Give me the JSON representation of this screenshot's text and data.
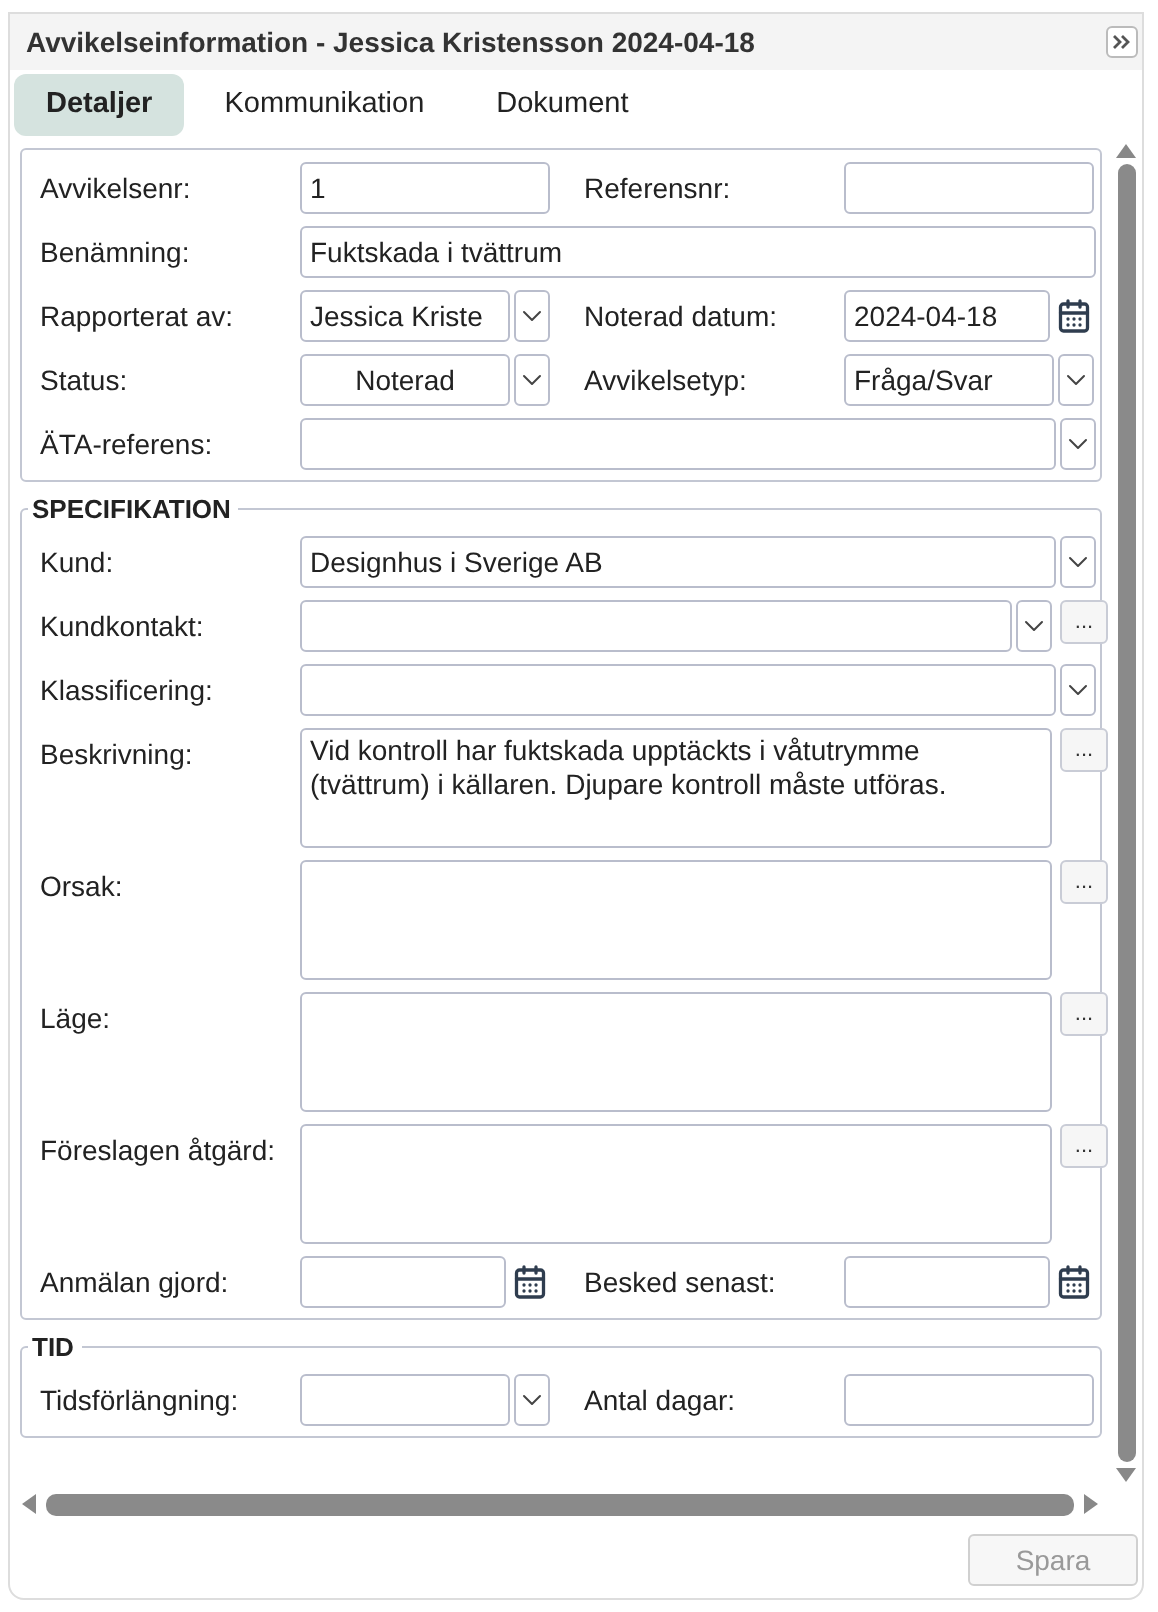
{
  "window": {
    "title": "Avvikelseinformation - Jessica Kristensson 2024-04-18"
  },
  "tabs": [
    {
      "label": "Detaljer",
      "selected": true
    },
    {
      "label": "Kommunikation",
      "selected": false
    },
    {
      "label": "Dokument",
      "selected": false
    }
  ],
  "sections": [
    {
      "rows": [
        {
          "kind": "pair",
          "fields": [
            {
              "label": "Avvikelsenr:",
              "kind": "text",
              "value": "1"
            },
            {
              "label": "Referensnr:",
              "kind": "text"
            }
          ]
        },
        {
          "kind": "full",
          "field": {
            "label": "Benämning:",
            "kind": "text",
            "value": "Fuktskada i tvättrum"
          }
        },
        {
          "kind": "pair",
          "fields": [
            {
              "label": "Rapporterat av:",
              "kind": "select",
              "value": "Jessica Kriste"
            },
            {
              "label": "Noterad datum:",
              "kind": "date",
              "value": "2024-04-18"
            }
          ]
        },
        {
          "kind": "pair",
          "fields": [
            {
              "label": "Status:",
              "kind": "select",
              "value": "Noterad",
              "centered": true
            },
            {
              "label": "Avvikelsetyp:",
              "kind": "select",
              "value": "Fråga/Svar"
            }
          ]
        },
        {
          "kind": "full",
          "field": {
            "label": "ÄTA-referens:",
            "kind": "select"
          }
        }
      ]
    },
    {
      "title": "SPECIFIKATION",
      "rows": [
        {
          "kind": "full",
          "field": {
            "label": "Kund:",
            "kind": "select",
            "value": "Designhus i Sverige AB"
          }
        },
        {
          "kind": "full",
          "field": {
            "label": "Kundkontakt:",
            "kind": "select",
            "more": "..."
          }
        },
        {
          "kind": "full",
          "field": {
            "label": "Klassificering:",
            "kind": "select"
          }
        },
        {
          "kind": "full",
          "field": {
            "label": "Beskrivning:",
            "kind": "textarea",
            "value": "Vid kontroll har fuktskada upptäckts i våtutrymme (tvättrum) i källaren. Djupare kontroll måste utföras.",
            "more": "..."
          }
        },
        {
          "kind": "full",
          "field": {
            "label": "Orsak:",
            "kind": "textarea",
            "more": "..."
          }
        },
        {
          "kind": "full",
          "field": {
            "label": "Läge:",
            "kind": "textarea",
            "more": "..."
          }
        },
        {
          "kind": "full",
          "field": {
            "label": "Föreslagen åtgärd:",
            "kind": "textarea",
            "more": "..."
          }
        },
        {
          "kind": "pair",
          "fields": [
            {
              "label": "Anmälan gjord:",
              "kind": "date"
            },
            {
              "label": "Besked senast:",
              "kind": "date"
            }
          ]
        }
      ]
    },
    {
      "title": "TID",
      "rows": [
        {
          "kind": "pair",
          "fields": [
            {
              "label": "Tidsförlängning:",
              "kind": "select"
            },
            {
              "label": "Antal dagar:",
              "kind": "text"
            }
          ]
        }
      ]
    }
  ],
  "footer": {
    "save_button": {
      "label": "Spara",
      "disabled": true
    }
  }
}
